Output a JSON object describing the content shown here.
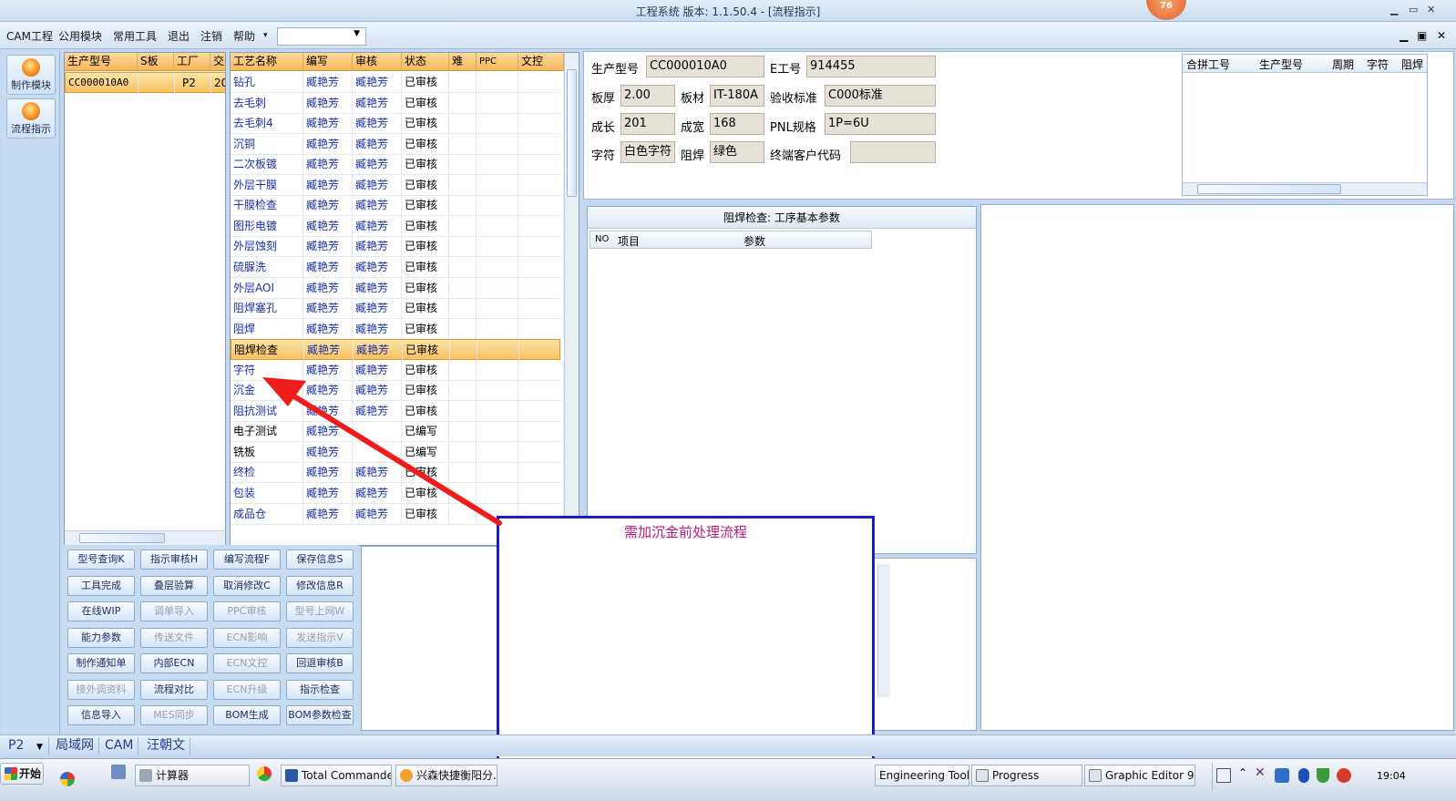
{
  "window": {
    "title": "工程系统  版本: 1.1.50.4 - [流程指示]",
    "badge": "76"
  },
  "menu": {
    "items": [
      "CAM工程",
      "公用模块",
      "常用工具",
      "退出",
      "注销",
      "帮助"
    ],
    "help_arrow": "▾",
    "combo_value": ""
  },
  "toolstrip": {
    "items": [
      {
        "label": "制作模块"
      },
      {
        "label": "流程指示"
      }
    ]
  },
  "product_list": {
    "columns": [
      "生产型号",
      "S板",
      "工厂",
      "交"
    ],
    "rows": [
      [
        "CC000010A0",
        "",
        "P2",
        "20"
      ]
    ]
  },
  "process_grid": {
    "columns": [
      "工艺名称",
      "编写",
      "审核",
      "状态",
      "难",
      "PPC",
      "文控"
    ],
    "rows": [
      [
        "钻孔",
        "臧艳芳",
        "臧艳芳",
        "已审核"
      ],
      [
        "去毛刺",
        "臧艳芳",
        "臧艳芳",
        "已审核"
      ],
      [
        "去毛刺4",
        "臧艳芳",
        "臧艳芳",
        "已审核"
      ],
      [
        "沉铜",
        "臧艳芳",
        "臧艳芳",
        "已审核"
      ],
      [
        "二次板镀",
        "臧艳芳",
        "臧艳芳",
        "已审核"
      ],
      [
        "外层干膜",
        "臧艳芳",
        "臧艳芳",
        "已审核"
      ],
      [
        "干膜检查",
        "臧艳芳",
        "臧艳芳",
        "已审核"
      ],
      [
        "图形电镀",
        "臧艳芳",
        "臧艳芳",
        "已审核"
      ],
      [
        "外层蚀刻",
        "臧艳芳",
        "臧艳芳",
        "已审核"
      ],
      [
        "硫脲洗",
        "臧艳芳",
        "臧艳芳",
        "已审核"
      ],
      [
        "外层AOI",
        "臧艳芳",
        "臧艳芳",
        "已审核"
      ],
      [
        "阻焊塞孔",
        "臧艳芳",
        "臧艳芳",
        "已审核"
      ],
      [
        "阻焊",
        "臧艳芳",
        "臧艳芳",
        "已审核"
      ],
      [
        "阻焊检查",
        "臧艳芳",
        "臧艳芳",
        "已审核"
      ],
      [
        "字符",
        "臧艳芳",
        "臧艳芳",
        "已审核"
      ],
      [
        "沉金",
        "臧艳芳",
        "臧艳芳",
        "已审核"
      ],
      [
        "阻抗测试",
        "臧艳芳",
        "臧艳芳",
        "已审核"
      ],
      [
        "电子测试",
        "臧艳芳",
        "",
        "已编写"
      ],
      [
        "铣板",
        "臧艳芳",
        "",
        "已编写"
      ],
      [
        "终检",
        "臧艳芳",
        "臧艳芳",
        "已审核"
      ],
      [
        "包装",
        "臧艳芳",
        "臧艳芳",
        "已审核"
      ],
      [
        "成品仓",
        "臧艳芳",
        "臧艳芳",
        "已审核"
      ]
    ],
    "selected_row_label": "阻焊检查"
  },
  "buttons": [
    [
      "型号查询K",
      "指示审核H",
      "编写流程F",
      "保存信息S"
    ],
    [
      "工具完成",
      "叠层验算",
      "取消修改C",
      "修改信息R"
    ],
    [
      "在线WIP",
      "调单导入",
      "PPC审核",
      "型号上网W"
    ],
    [
      "能力参数",
      "传送文件",
      "ECN影响",
      "发送指示V"
    ],
    [
      "制作通知单",
      "内部ECN",
      "ECN文控",
      "回退审核B"
    ],
    [
      "接外调资料",
      "流程对比",
      "ECN升级",
      "指示检查"
    ],
    [
      "信息导入",
      "MES同步",
      "BOM生成",
      "BOM参数检查"
    ]
  ],
  "buttons_disabled": [
    [
      false,
      false,
      false,
      false
    ],
    [
      false,
      false,
      false,
      false
    ],
    [
      false,
      true,
      true,
      true
    ],
    [
      false,
      true,
      true,
      true
    ],
    [
      false,
      false,
      true,
      false
    ],
    [
      true,
      false,
      true,
      false
    ],
    [
      false,
      true,
      false,
      false
    ]
  ],
  "info": {
    "fields": [
      {
        "label": "生产型号",
        "value": "CC000010A0"
      },
      {
        "label": "E工号",
        "value": "914455"
      },
      {
        "label": "板厚",
        "value": "2.00"
      },
      {
        "label": "板材",
        "value": "IT-180A"
      },
      {
        "label": "验收标准",
        "value": "C000标准"
      },
      {
        "label": "成长",
        "value": "201"
      },
      {
        "label": "成宽",
        "value": "168"
      },
      {
        "label": "PNL规格",
        "value": "1P=6U"
      },
      {
        "label": "字符",
        "value": "白色字符"
      },
      {
        "label": "阻焊",
        "value": "绿色"
      },
      {
        "label": "终端客户代码",
        "value": ""
      }
    ]
  },
  "merge_grid": {
    "columns": [
      "合拼工号",
      "生产型号",
      "周期",
      "字符",
      "阻焊"
    ]
  },
  "param_panel": {
    "title": "阻焊检查: 工序基本参数",
    "columns": [
      "NO",
      "项目",
      "参数"
    ]
  },
  "callout": {
    "text": "需加沉金前处理流程"
  },
  "status_tabs": [
    "P2",
    "局域网",
    "CAM",
    "汪朝文"
  ],
  "taskbar": {
    "start_label": "开始",
    "tasks": [
      "计算器",
      "Total Commander ...",
      "兴森快捷衡阳分...",
      "Engineering Toolki...",
      "Progress",
      "Graphic Editor 9.0..."
    ],
    "clock": "19:04"
  },
  "colors": {
    "accent_header": "#f7b85c",
    "selected_row": "#f7c260",
    "callout_border": "#1b1bc9",
    "callout_text": "#c2187e",
    "arrow": "#ef1c1c"
  }
}
